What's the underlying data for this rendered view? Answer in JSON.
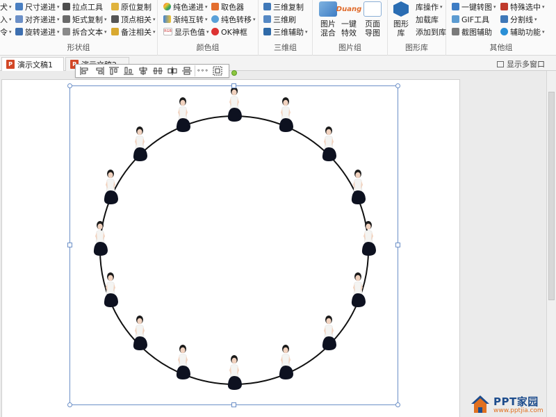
{
  "ribbon": {
    "groups": {
      "shape": {
        "label": "形状组",
        "col0": [
          "犬",
          "入",
          "令"
        ],
        "col1": [
          "尺寸递进",
          "对齐递进",
          "旋转递进"
        ],
        "col2": [
          "拉点工具",
          "矩式复制",
          "拆合文本"
        ],
        "col3": [
          "原位复制",
          "顶点相关",
          "备注相关"
        ]
      },
      "color": {
        "label": "颜色组",
        "col1": [
          "纯色递进",
          "渐纯互转",
          "显示色值"
        ],
        "col2": [
          "取色器",
          "纯色转移",
          "OK神框"
        ]
      },
      "threed": {
        "label": "三维组",
        "items": [
          "三维复制",
          "三维刷",
          "三维辅助"
        ]
      },
      "image": {
        "label": "图片组",
        "buttons": [
          {
            "label": "图片\n混合",
            "icon": "image-blend-icon"
          },
          {
            "label": "一键\n特效",
            "icon": "duang-icon",
            "badge": "Duang"
          },
          {
            "label": "页面\n导图",
            "icon": "page-export-icon"
          }
        ]
      },
      "library": {
        "label": "图形库",
        "bigbutton": "图形\n库",
        "items": [
          "库操作",
          "加载库",
          "添加到库"
        ]
      },
      "other": {
        "label": "其他组",
        "col1": [
          "一键转图",
          "GIF工具",
          "截图辅助"
        ],
        "col2": [
          "特殊选中",
          "分割线",
          "辅助功能"
        ]
      }
    }
  },
  "tabs": [
    {
      "label": "演示文稿1",
      "icon": "P"
    },
    {
      "label": "演示文稿2",
      "icon": "P"
    }
  ],
  "multiwindow_label": "显示多窗口",
  "align_toolbar": {
    "buttons": [
      "align-left-icon",
      "align-right-icon",
      "align-top-icon",
      "align-bottom-icon",
      "align-center-h-icon",
      "distribute-h-icon",
      "distribute-v-icon",
      "align-middle-icon",
      "more-icon",
      "group-icon"
    ],
    "more_label": "∘∘∘"
  },
  "watermark": {
    "main": "PPT家园",
    "url": "www.pptjia.com"
  },
  "colors": {
    "accent": "#6b8fc7",
    "rotate_handle": "#8dc63f",
    "ppt_icon": "#d24726",
    "logo_blue": "#1d4c8c",
    "logo_orange": "#e07020"
  }
}
